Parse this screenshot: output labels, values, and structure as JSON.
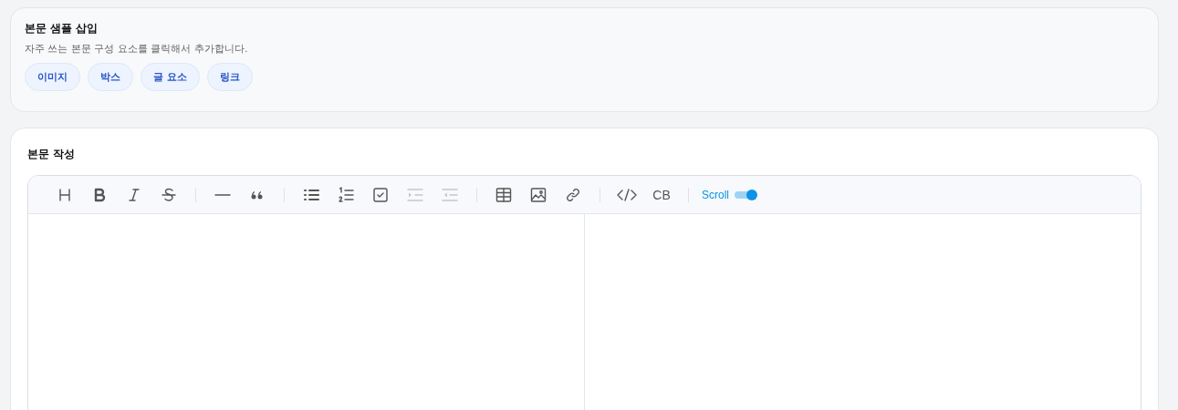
{
  "sample_panel": {
    "title": "본문 샘플 삽입",
    "description": "자주 쓰는 본문 구성 요소를 클릭해서 추가합니다.",
    "chips": [
      "이미지",
      "박스",
      "글 요소",
      "링크"
    ]
  },
  "editor_panel": {
    "title": "본문 작성",
    "toolbar": {
      "groups": [
        {
          "items": [
            {
              "kind": "heading",
              "disabled": false
            },
            {
              "kind": "bold",
              "disabled": false
            },
            {
              "kind": "italic",
              "disabled": false
            },
            {
              "kind": "strike",
              "disabled": false
            }
          ]
        },
        {
          "items": [
            {
              "kind": "hr",
              "disabled": false
            },
            {
              "kind": "quote",
              "disabled": false
            }
          ]
        },
        {
          "items": [
            {
              "kind": "bullet-list",
              "disabled": false
            },
            {
              "kind": "ordered-list",
              "disabled": false
            },
            {
              "kind": "task",
              "disabled": false
            },
            {
              "kind": "indent",
              "disabled": true
            },
            {
              "kind": "outdent",
              "disabled": true
            }
          ]
        },
        {
          "items": [
            {
              "kind": "table",
              "disabled": false
            },
            {
              "kind": "image",
              "disabled": false
            },
            {
              "kind": "link",
              "disabled": false
            }
          ]
        },
        {
          "items": [
            {
              "kind": "code",
              "disabled": false
            },
            {
              "kind": "codeblock",
              "disabled": false,
              "label": "CB"
            }
          ]
        }
      ],
      "scroll_sync": {
        "label": "Scroll",
        "on": true
      }
    }
  }
}
